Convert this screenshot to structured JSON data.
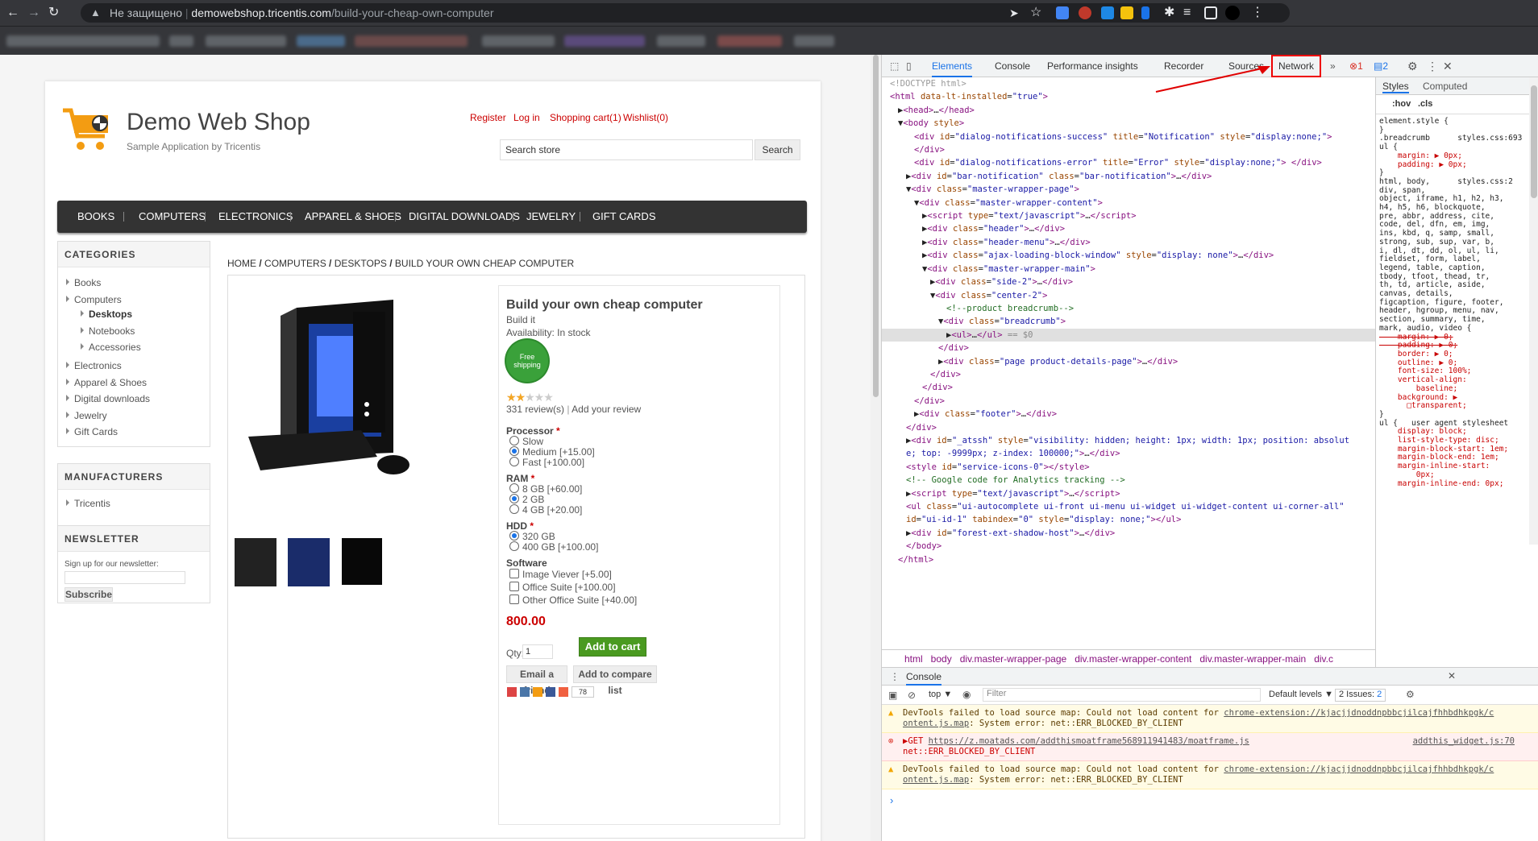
{
  "browser": {
    "not_secure": "Не защищено",
    "domain": "demowebshop.tricentis.com",
    "path": "/build-your-cheap-own-computer"
  },
  "site": {
    "logo_title": "Demo Web Shop",
    "logo_subtitle": "Sample Application by Tricentis",
    "header_links": [
      "Register",
      "Log in",
      "Shopping cart(1)",
      "Wishlist(0)"
    ],
    "search_placeholder": "Search store",
    "search_button": "Search",
    "menu": [
      "BOOKS",
      "COMPUTERS",
      "ELECTRONICS",
      "APPAREL & SHOES",
      "DIGITAL DOWNLOADS",
      "JEWELRY",
      "GIFT CARDS"
    ],
    "categories_title": "CATEGORIES",
    "categories": [
      "Books",
      "Computers",
      "Desktops",
      "Notebooks",
      "Accessories",
      "Electronics",
      "Apparel & Shoes",
      "Digital downloads",
      "Jewelry",
      "Gift Cards"
    ],
    "manufacturers_title": "MANUFACTURERS",
    "manufacturers": [
      "Tricentis"
    ],
    "newsletter_title": "NEWSLETTER",
    "newsletter_text": "Sign up for our newsletter:",
    "newsletter_button": "Subscribe",
    "breadcrumb": [
      "HOME",
      "COMPUTERS",
      "DESKTOPS",
      "BUILD YOUR OWN CHEAP COMPUTER"
    ],
    "breadcrumb_sep": "/"
  },
  "product": {
    "name": "Build your own cheap computer",
    "short": "Build it",
    "availability": "Availability: In stock",
    "badge": "Free shipping",
    "rating_fraction": 0.4,
    "reviews": "331 review(s)",
    "review_sep": "|",
    "add_review": "Add your review",
    "processor_label": "Processor",
    "processor": [
      "Slow",
      "Medium [+15.00]",
      "Fast [+100.00]"
    ],
    "ram_label": "RAM",
    "ram": [
      "8 GB [+60.00]",
      "2 GB",
      "4 GB [+20.00]"
    ],
    "hdd_label": "HDD",
    "hdd": [
      "320 GB",
      "400 GB [+100.00]"
    ],
    "software_label": "Software",
    "software": [
      "Image Viever [+5.00]",
      "Office Suite [+100.00]",
      "Other Office Suite [+40.00]"
    ],
    "required": "*",
    "price": "800.00",
    "qty_label": "Qty:",
    "qty": "1",
    "add_to_cart": "Add to cart",
    "email_friend": "Email a friend",
    "compare": "Add to compare list",
    "share_count": "78"
  },
  "devtools": {
    "tabs": [
      "Elements",
      "Console",
      "Performance insights",
      "Recorder",
      "Sources",
      "Network"
    ],
    "more": "»",
    "errors": "1",
    "messages": "2",
    "dom_lines": [
      {
        "indent": 0,
        "html": "<span style='color:#999'>&lt;!DOCTYPE html&gt;</span>"
      },
      {
        "indent": 0,
        "html": "<span class='tg'>&lt;html</span> <span class='an'>data-lt-installed</span>=<span class='av'>\"true\"</span><span class='tg'>&gt;</span>"
      },
      {
        "indent": 1,
        "html": "▶<span class='tg'>&lt;head&gt;</span>…<span class='tg'>&lt;/head&gt;</span>"
      },
      {
        "indent": 1,
        "html": "▼<span class='tg'>&lt;body</span> <span class='an'>style</span><span class='tg'>&gt;</span>"
      },
      {
        "indent": 3,
        "html": "<span class='tg'>&lt;div</span> <span class='an'>id</span>=<span class='av'>\"dialog-notifications-success\"</span> <span class='an'>title</span>=<span class='av'>\"Notification\"</span> <span class='an'>style</span>=<span class='av'>\"display:none;\"</span><span class='tg'>&gt;</span>"
      },
      {
        "indent": 3,
        "html": "<span class='tg'>&lt;/div&gt;</span>"
      },
      {
        "indent": 3,
        "html": "<span class='tg'>&lt;div</span> <span class='an'>id</span>=<span class='av'>\"dialog-notifications-error\"</span> <span class='an'>title</span>=<span class='av'>\"Error\"</span> <span class='an'>style</span>=<span class='av'>\"display:none;\"</span><span class='tg'>&gt;</span> <span class='tg'>&lt;/div&gt;</span>"
      },
      {
        "indent": 2,
        "html": "▶<span class='tg'>&lt;div</span> <span class='an'>id</span>=<span class='av'>\"bar-notification\"</span> <span class='an'>class</span>=<span class='av'>\"bar-notification\"</span><span class='tg'>&gt;</span>…<span class='tg'>&lt;/div&gt;</span>"
      },
      {
        "indent": 2,
        "html": "▼<span class='tg'>&lt;div</span> <span class='an'>class</span>=<span class='av'>\"master-wrapper-page\"</span><span class='tg'>&gt;</span>"
      },
      {
        "indent": 3,
        "html": "▼<span class='tg'>&lt;div</span> <span class='an'>class</span>=<span class='av'>\"master-wrapper-content\"</span><span class='tg'>&gt;</span>"
      },
      {
        "indent": 4,
        "html": "▶<span class='tg'>&lt;script</span> <span class='an'>type</span>=<span class='av'>\"text/javascript\"</span><span class='tg'>&gt;</span>…<span class='tg'>&lt;/script&gt;</span>"
      },
      {
        "indent": 4,
        "html": "▶<span class='tg'>&lt;div</span> <span class='an'>class</span>=<span class='av'>\"header\"</span><span class='tg'>&gt;</span>…<span class='tg'>&lt;/div&gt;</span>"
      },
      {
        "indent": 4,
        "html": "▶<span class='tg'>&lt;div</span> <span class='an'>class</span>=<span class='av'>\"header-menu\"</span><span class='tg'>&gt;</span>…<span class='tg'>&lt;/div&gt;</span>"
      },
      {
        "indent": 4,
        "html": "▶<span class='tg'>&lt;div</span> <span class='an'>class</span>=<span class='av'>\"ajax-loading-block-window\"</span> <span class='an'>style</span>=<span class='av'>\"display: none\"</span><span class='tg'>&gt;</span>…<span class='tg'>&lt;/div&gt;</span>"
      },
      {
        "indent": 4,
        "html": "▼<span class='tg'>&lt;div</span> <span class='an'>class</span>=<span class='av'>\"master-wrapper-main\"</span><span class='tg'>&gt;</span>"
      },
      {
        "indent": 5,
        "html": "▶<span class='tg'>&lt;div</span> <span class='an'>class</span>=<span class='av'>\"side-2\"</span><span class='tg'>&gt;</span>…<span class='tg'>&lt;/div&gt;</span>"
      },
      {
        "indent": 5,
        "html": "▼<span class='tg'>&lt;div</span> <span class='an'>class</span>=<span class='av'>\"center-2\"</span><span class='tg'>&gt;</span>"
      },
      {
        "indent": 7,
        "html": "<span class='cm'>&lt;!--product breadcrumb--&gt;</span>"
      },
      {
        "indent": 6,
        "html": "▼<span class='tg'>&lt;div</span> <span class='an'>class</span>=<span class='av'>\"breadcrumb\"</span><span class='tg'>&gt;</span>"
      },
      {
        "indent": 7,
        "html": "▶<span class='tg'>&lt;ul&gt;</span>…<span class='tg'>&lt;/ul&gt;</span> <span style='color:#888'>== $0</span>",
        "selected": true
      },
      {
        "indent": 6,
        "html": "<span class='tg'>&lt;/div&gt;</span>"
      },
      {
        "indent": 6,
        "html": "▶<span class='tg'>&lt;div</span> <span class='an'>class</span>=<span class='av'>\"page product-details-page\"</span><span class='tg'>&gt;</span>…<span class='tg'>&lt;/div&gt;</span>"
      },
      {
        "indent": 5,
        "html": "<span class='tg'>&lt;/div&gt;</span>"
      },
      {
        "indent": 4,
        "html": "<span class='tg'>&lt;/div&gt;</span>"
      },
      {
        "indent": 3,
        "html": "<span class='tg'>&lt;/div&gt;</span>"
      },
      {
        "indent": 3,
        "html": "▶<span class='tg'>&lt;div</span> <span class='an'>class</span>=<span class='av'>\"footer\"</span><span class='tg'>&gt;</span>…<span class='tg'>&lt;/div&gt;</span>"
      },
      {
        "indent": 2,
        "html": "<span class='tg'>&lt;/div&gt;</span>"
      },
      {
        "indent": 2,
        "html": "▶<span class='tg'>&lt;div</span> <span class='an'>id</span>=<span class='av'>\"_atssh\"</span> <span class='an'>style</span>=<span class='av'>\"visibility: hidden; height: 1px; width: 1px; position: absolut</span>"
      },
      {
        "indent": 2,
        "html": "<span class='av'>e; top: -9999px; z-index: 100000;\"</span><span class='tg'>&gt;</span>…<span class='tg'>&lt;/div&gt;</span>"
      },
      {
        "indent": 2,
        "html": "<span class='tg'>&lt;style</span> <span class='an'>id</span>=<span class='av'>\"service-icons-0\"</span><span class='tg'>&gt;</span><span class='tg'>&lt;/style&gt;</span>"
      },
      {
        "indent": 2,
        "html": "<span class='cm'>&lt;!-- Google code for Analytics tracking --&gt;</span>"
      },
      {
        "indent": 2,
        "html": "▶<span class='tg'>&lt;script</span> <span class='an'>type</span>=<span class='av'>\"text/javascript\"</span><span class='tg'>&gt;</span>…<span class='tg'>&lt;/script&gt;</span>"
      },
      {
        "indent": 2,
        "html": "<span class='tg'>&lt;ul</span> <span class='an'>class</span>=<span class='av'>\"ui-autocomplete ui-front ui-menu ui-widget ui-widget-content ui-corner-all\"</span>"
      },
      {
        "indent": 2,
        "html": "<span class='an'>id</span>=<span class='av'>\"ui-id-1\"</span> <span class='an'>tabindex</span>=<span class='av'>\"0\"</span> <span class='an'>style</span>=<span class='av'>\"display: none;\"</span><span class='tg'>&gt;&lt;/ul&gt;</span>"
      },
      {
        "indent": 2,
        "html": "▶<span class='tg'>&lt;div</span> <span class='an'>id</span>=<span class='av'>\"forest-ext-shadow-host\"</span><span class='tg'>&gt;</span>…<span class='tg'>&lt;/div&gt;</span>"
      },
      {
        "indent": 2,
        "html": "<span class='tg'>&lt;/body&gt;</span>"
      },
      {
        "indent": 1,
        "html": "<span class='tg'>&lt;/html&gt;</span>"
      }
    ],
    "dom_breadcrumb": [
      "html",
      "body",
      "div.master-wrapper-page",
      "div.master-wrapper-content",
      "div.master-wrapper-main",
      "div.c"
    ],
    "styles_tabs": [
      "Styles",
      "Computed"
    ],
    "styles_toolbar": [
      ":hov",
      ".cls"
    ],
    "styles_lines": [
      "element.style {",
      "}",
      ".breadcrumb      styles.css:693",
      "ul {",
      "    margin: ▶ 0px;",
      "    padding: ▶ 0px;",
      "}",
      "html, body,      styles.css:2",
      "div, span,",
      "object, iframe, h1, h2, h3,",
      "h4, h5, h6, blockquote,",
      "pre, abbr, address, cite,",
      "code, del, dfn, em, img,",
      "ins, kbd, q, samp, small,",
      "strong, sub, sup, var, b,",
      "i, dl, dt, dd, ol, ul, li,",
      "fieldset, form, label,",
      "legend, table, caption,",
      "tbody, tfoot, thead, tr,",
      "th, td, article, aside,",
      "canvas, details,",
      "figcaption, figure, footer,",
      "header, hgroup, menu, nav,",
      "section, summary, time,",
      "mark, audio, video {",
      "    margin: ▶ 0;",
      "    padding: ▶ 0;",
      "    border: ▶ 0;",
      "    outline: ▶ 0;",
      "    font-size: 100%;",
      "    vertical-align:",
      "        baseline;",
      "    background: ▶",
      "      □transparent;",
      "}",
      "ul {   user agent stylesheet",
      "    display: block;",
      "    list-style-type: disc;",
      "    margin-block-start: 1em;",
      "    margin-block-end: 1em;",
      "    margin-inline-start:",
      "        0px;",
      "    margin-inline-end: 0px;"
    ],
    "console_title": "Console",
    "console_top": "top ▼",
    "console_filter": "Filter",
    "console_levels": "Default levels ▼",
    "console_issues": "2 Issues:",
    "console_issues_count": "2",
    "console_msgs": [
      {
        "type": "warn",
        "text": "DevTools failed to load source map: Could not load content for ",
        "link": "chrome-extension://kjacjjdnoddnpbbcjilcajfhhbdhkpgk/c",
        "text2": "ontent.js.map",
        "text3": ": System error: net::ERR_BLOCKED_BY_CLIENT"
      },
      {
        "type": "error",
        "text": "▶GET ",
        "link": "https://z.moatads.com/addthismoatframe568911941483/moatframe.js",
        "src": "addthis_widget.js:70",
        "text2": "",
        "text3": "net::ERR_BLOCKED_BY_CLIENT"
      },
      {
        "type": "warn",
        "text": "DevTools failed to load source map: Could not load content for ",
        "link": "chrome-extension://kjacjjdnoddnpbbcjilcajfhhbdhkpgk/c",
        "text2": "ontent.js.map",
        "text3": ": System error: net::ERR_BLOCKED_BY_CLIENT"
      }
    ],
    "prompt": "›"
  },
  "colors": {
    "accent_red": "#e00000",
    "price": "#c00000",
    "cart_green": "#4a9a20"
  }
}
